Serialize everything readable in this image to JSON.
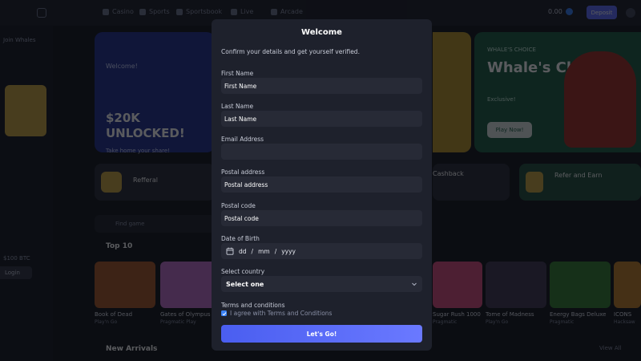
{
  "background": {
    "nav": [
      {
        "label": "Casino"
      },
      {
        "label": "Sports"
      },
      {
        "label": "Sportsbook"
      },
      {
        "label": "Live"
      },
      {
        "label": "Arcade"
      }
    ],
    "balance": "0.00",
    "deposit_label": "Deposit",
    "sidebar_text": "Join Whales",
    "sidebar_button": "Login",
    "sidebar_bonus": "$100 BTC",
    "banner1": {
      "tag": "Welcome!",
      "headline": "$20K UNLOCKED!",
      "sub": "Take home your share!"
    },
    "banner2": {
      "tag": "WHALE'S CHOICE",
      "headline": "Whale's Choice",
      "sub": "Exclusive!",
      "button": "Play Now!"
    },
    "promo1_title": "Refferal",
    "promo2_title": "Cashback",
    "promo3_title": "Refer and Earn",
    "search_placeholder": "Find game",
    "section1": "Top 10",
    "section2": "New Arrivals",
    "view_all": "View All",
    "tiles": [
      {
        "name": "Book of Dead",
        "provider": "Play'n Go",
        "color": "#a8521f"
      },
      {
        "name": "Gates of Olympus",
        "provider": "Pragmatic Play",
        "color": "#c06acb"
      },
      {
        "name": "Sugar Rush 1000",
        "provider": "Pragmatic",
        "color": "#d8457a"
      },
      {
        "name": "Tome of Madness",
        "provider": "Play'n Go",
        "color": "#3b2f4a"
      },
      {
        "name": "Energy Bags Deluxe",
        "provider": "Pragmatic",
        "color": "#2f7a2a"
      },
      {
        "name": "ICONS",
        "provider": "Hacksaw",
        "color": "#c07a1f"
      }
    ]
  },
  "modal": {
    "title": "Welcome",
    "subtitle": "Confirm your details and get yourself verified.",
    "fields": {
      "first_name": {
        "label": "First Name",
        "placeholder": "First Name"
      },
      "last_name": {
        "label": "Last Name",
        "placeholder": "Last Name"
      },
      "email": {
        "label": "Email Address",
        "placeholder": ""
      },
      "postal_address": {
        "label": "Postal address",
        "placeholder": "Postal address"
      },
      "postal_code": {
        "label": "Postal code",
        "placeholder": "Postal code"
      }
    },
    "dob": {
      "label": "Date of Birth",
      "dd": "dd",
      "mm": "mm",
      "yyyy": "yyyy",
      "sep": "/"
    },
    "country": {
      "label": "Select country",
      "value": "Select one"
    },
    "terms": {
      "label": "Terms and conditions",
      "checkbox_text": "I agree with Terms and Conditions",
      "checked": true
    },
    "submit_label": "Let's Go!",
    "accent": "#5b6bff"
  }
}
